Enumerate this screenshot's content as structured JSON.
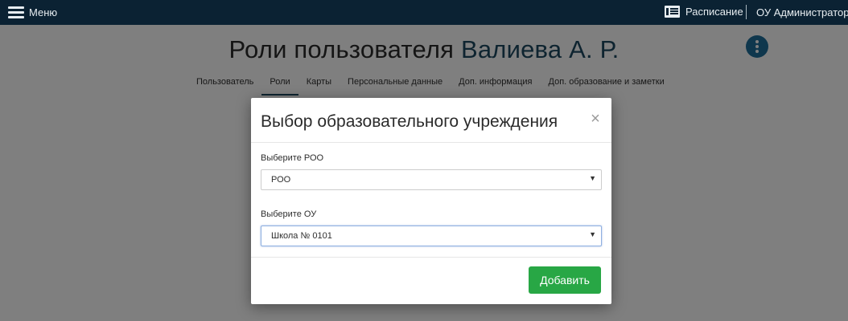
{
  "topbar": {
    "menu_label": "Меню",
    "schedule_label": "Расписание",
    "schedule_icon": "schedule-icon",
    "user_role": "ОУ Администратор"
  },
  "page": {
    "title_prefix": "Роли пользователя",
    "title_name": "Валиева А. Р.",
    "tabs": [
      {
        "label": "Пользователь",
        "active": false
      },
      {
        "label": "Роли",
        "active": true
      },
      {
        "label": "Карты",
        "active": false
      },
      {
        "label": "Персональные данные",
        "active": false
      },
      {
        "label": "Доп. информация",
        "active": false
      },
      {
        "label": "Доп. образование и заметки",
        "active": false
      }
    ]
  },
  "modal": {
    "title": "Выбор образовательного учреждения",
    "close_glyph": "×",
    "roo_label": "Выберите РОО",
    "roo_value": "РОО",
    "ou_label": "Выберите ОУ",
    "ou_value": "Школа № 0101",
    "caret_glyph": "▼",
    "add_button": "Добавить"
  },
  "colors": {
    "topbar": "#0b2233",
    "accent": "#1d4860",
    "add_button": "#28a745"
  }
}
